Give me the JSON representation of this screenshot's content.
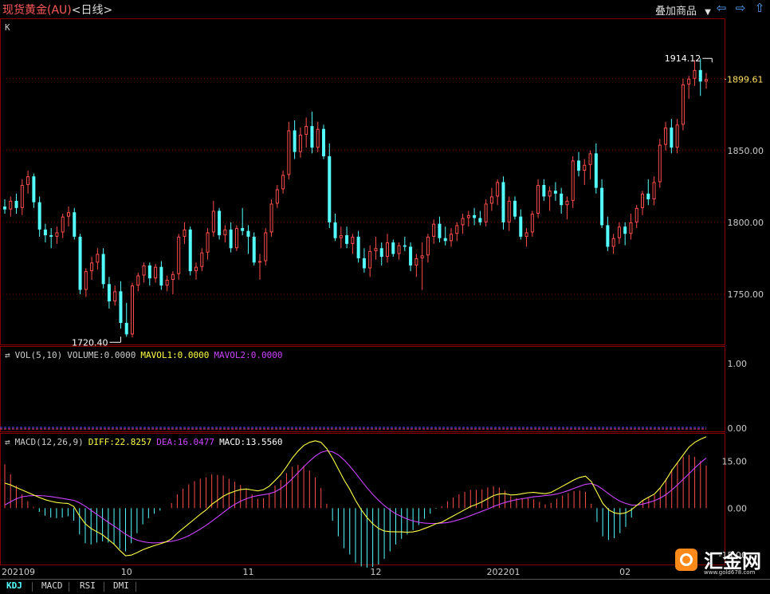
{
  "header": {
    "title": "现货黄金(AU)",
    "period": "<日线>",
    "overlay_label": "叠加商品",
    "overlay_arrow": "▼"
  },
  "colors": {
    "up": "#ff4d4d",
    "down": "#54ffff",
    "grid": "#8a0000",
    "diff": "#ffff44",
    "dea": "#cc44ff",
    "macd_up": "#ff4d4d",
    "macd_down": "#54ffff",
    "axis_text": "#cccccc",
    "vol_line": "#5050ff"
  },
  "main_panel": {
    "label": "K",
    "current_price": "1899.61",
    "high_label": "1914.12",
    "low_label": "1720.40"
  },
  "vol_panel": {
    "icon": "⇄",
    "name": "VOL(5,10)",
    "volume": "VOLUME:0.0000",
    "mavol1": "MAVOL1:0.0000",
    "mavol2": "MAVOL2:0.0000"
  },
  "macd_panel": {
    "icon": "⇄",
    "name": "MACD(12,26,9)",
    "diff": "DIFF:22.8257",
    "dea": "DEA:16.0477",
    "macd": "MACD:13.5560"
  },
  "tabs": [
    "KDJ",
    "MACD",
    "RSI",
    "DMI"
  ],
  "watermark": {
    "brand": "汇金网",
    "site": "www.gold678.com"
  },
  "chart_data": [
    {
      "type": "candlestick",
      "y_ticks": [
        1750,
        1800,
        1850
      ],
      "ylim": [
        1715,
        1942
      ],
      "x_tick_labels": [
        {
          "label": "202109",
          "index": 0
        },
        {
          "label": "10",
          "index": 21
        },
        {
          "label": "11",
          "index": 42
        },
        {
          "label": "12",
          "index": 64
        },
        {
          "label": "202201",
          "index": 86
        },
        {
          "label": "02",
          "index": 107
        }
      ],
      "annotations": [
        {
          "text": "1914.12",
          "value": 1914.12,
          "index": 122
        },
        {
          "text": "1720.40",
          "value": 1720.4,
          "index": 20
        },
        {
          "text": "1899.61",
          "value": 1899.61,
          "index": 124
        }
      ],
      "candles": [
        [
          1811,
          1816,
          1806,
          1809
        ],
        [
          1809,
          1818,
          1804,
          1815
        ],
        [
          1815,
          1820,
          1806,
          1810
        ],
        [
          1810,
          1830,
          1805,
          1826
        ],
        [
          1826,
          1836,
          1820,
          1832
        ],
        [
          1832,
          1834,
          1810,
          1814
        ],
        [
          1814,
          1818,
          1790,
          1795
        ],
        [
          1795,
          1799,
          1786,
          1791
        ],
        [
          1791,
          1796,
          1782,
          1790
        ],
        [
          1790,
          1797,
          1785,
          1793
        ],
        [
          1793,
          1806,
          1789,
          1804
        ],
        [
          1804,
          1811,
          1797,
          1807
        ],
        [
          1807,
          1810,
          1788,
          1790
        ],
        [
          1790,
          1792,
          1750,
          1753
        ],
        [
          1753,
          1768,
          1748,
          1766
        ],
        [
          1766,
          1776,
          1760,
          1772
        ],
        [
          1772,
          1782,
          1767,
          1778
        ],
        [
          1778,
          1782,
          1754,
          1757
        ],
        [
          1757,
          1762,
          1740,
          1745
        ],
        [
          1745,
          1756,
          1742,
          1752
        ],
        [
          1752,
          1759,
          1726,
          1730
        ],
        [
          1730,
          1744,
          1720.4,
          1722
        ],
        [
          1722,
          1758,
          1720,
          1756
        ],
        [
          1756,
          1765,
          1752,
          1763
        ],
        [
          1763,
          1772,
          1758,
          1770
        ],
        [
          1770,
          1772,
          1756,
          1761
        ],
        [
          1761,
          1771,
          1758,
          1769
        ],
        [
          1769,
          1773,
          1753,
          1756
        ],
        [
          1756,
          1763,
          1752,
          1760
        ],
        [
          1760,
          1766,
          1750,
          1764
        ],
        [
          1764,
          1792,
          1760,
          1790
        ],
        [
          1790,
          1800,
          1785,
          1795
        ],
        [
          1795,
          1797,
          1763,
          1766
        ],
        [
          1766,
          1772,
          1760,
          1769
        ],
        [
          1769,
          1782,
          1766,
          1779
        ],
        [
          1779,
          1796,
          1774,
          1793
        ],
        [
          1793,
          1815,
          1790,
          1808
        ],
        [
          1808,
          1810,
          1788,
          1791
        ],
        [
          1791,
          1798,
          1786,
          1795
        ],
        [
          1795,
          1800,
          1779,
          1782
        ],
        [
          1782,
          1798,
          1780,
          1796
        ],
        [
          1796,
          1810,
          1791,
          1794
        ],
        [
          1794,
          1798,
          1778,
          1790
        ],
        [
          1790,
          1793,
          1770,
          1772
        ],
        [
          1772,
          1778,
          1760,
          1773
        ],
        [
          1773,
          1796,
          1770,
          1793
        ],
        [
          1793,
          1816,
          1790,
          1813
        ],
        [
          1813,
          1826,
          1810,
          1823
        ],
        [
          1823,
          1836,
          1820,
          1833
        ],
        [
          1833,
          1870,
          1830,
          1864
        ],
        [
          1864,
          1871,
          1844,
          1849
        ],
        [
          1849,
          1866,
          1845,
          1861
        ],
        [
          1861,
          1873,
          1852,
          1867
        ],
        [
          1867,
          1877,
          1848,
          1852
        ],
        [
          1852,
          1870,
          1849,
          1865
        ],
        [
          1865,
          1868,
          1844,
          1846
        ],
        [
          1846,
          1855,
          1796,
          1800
        ],
        [
          1800,
          1806,
          1787,
          1789
        ],
        [
          1789,
          1797,
          1782,
          1791
        ],
        [
          1791,
          1797,
          1782,
          1785
        ],
        [
          1785,
          1792,
          1778,
          1790
        ],
        [
          1790,
          1794,
          1772,
          1775
        ],
        [
          1775,
          1782,
          1765,
          1768
        ],
        [
          1768,
          1784,
          1762,
          1780
        ],
        [
          1780,
          1790,
          1774,
          1782
        ],
        [
          1782,
          1786,
          1770,
          1776
        ],
        [
          1776,
          1792,
          1772,
          1786
        ],
        [
          1786,
          1788,
          1776,
          1778
        ],
        [
          1778,
          1786,
          1774,
          1784
        ],
        [
          1784,
          1790,
          1780,
          1783
        ],
        [
          1783,
          1786,
          1766,
          1770
        ],
        [
          1770,
          1778,
          1762,
          1775
        ],
        [
          1775,
          1786,
          1753,
          1777
        ],
        [
          1777,
          1792,
          1772,
          1790
        ],
        [
          1790,
          1802,
          1785,
          1799
        ],
        [
          1799,
          1804,
          1786,
          1789
        ],
        [
          1789,
          1797,
          1784,
          1787
        ],
        [
          1787,
          1796,
          1783,
          1792
        ],
        [
          1792,
          1800,
          1787,
          1798
        ],
        [
          1798,
          1806,
          1792,
          1803
        ],
        [
          1803,
          1808,
          1797,
          1805
        ],
        [
          1805,
          1810,
          1798,
          1803
        ],
        [
          1803,
          1808,
          1798,
          1800
        ],
        [
          1800,
          1816,
          1797,
          1813
        ],
        [
          1813,
          1824,
          1808,
          1818
        ],
        [
          1818,
          1830,
          1812,
          1828
        ],
        [
          1828,
          1832,
          1795,
          1800
        ],
        [
          1800,
          1818,
          1794,
          1815
        ],
        [
          1815,
          1818,
          1802,
          1804
        ],
        [
          1804,
          1809,
          1788,
          1790
        ],
        [
          1790,
          1796,
          1783,
          1793
        ],
        [
          1793,
          1808,
          1790,
          1806
        ],
        [
          1806,
          1830,
          1803,
          1826
        ],
        [
          1826,
          1830,
          1815,
          1818
        ],
        [
          1818,
          1825,
          1808,
          1822
        ],
        [
          1822,
          1828,
          1815,
          1820
        ],
        [
          1820,
          1824,
          1806,
          1812
        ],
        [
          1812,
          1818,
          1802,
          1815
        ],
        [
          1815,
          1846,
          1810,
          1843
        ],
        [
          1843,
          1849,
          1832,
          1836
        ],
        [
          1836,
          1844,
          1826,
          1840
        ],
        [
          1840,
          1850,
          1830,
          1848
        ],
        [
          1848,
          1855,
          1820,
          1824
        ],
        [
          1824,
          1830,
          1796,
          1798
        ],
        [
          1798,
          1804,
          1780,
          1783
        ],
        [
          1783,
          1792,
          1778,
          1789
        ],
        [
          1789,
          1800,
          1785,
          1797
        ],
        [
          1797,
          1800,
          1784,
          1792
        ],
        [
          1792,
          1806,
          1788,
          1800
        ],
        [
          1800,
          1812,
          1796,
          1810
        ],
        [
          1810,
          1822,
          1805,
          1820
        ],
        [
          1820,
          1830,
          1812,
          1816
        ],
        [
          1816,
          1832,
          1812,
          1828
        ],
        [
          1828,
          1858,
          1824,
          1854
        ],
        [
          1854,
          1870,
          1850,
          1866
        ],
        [
          1866,
          1872,
          1848,
          1852
        ],
        [
          1852,
          1872,
          1848,
          1868
        ],
        [
          1868,
          1900,
          1864,
          1896
        ],
        [
          1896,
          1902,
          1886,
          1900
        ],
        [
          1900,
          1913,
          1895,
          1906
        ],
        [
          1906,
          1914.12,
          1888,
          1898
        ],
        [
          1898,
          1904,
          1893,
          1899.61
        ]
      ]
    },
    {
      "type": "line",
      "title": "VOL(5,10)",
      "y_ticks": [
        0.0,
        1.0
      ],
      "ylim": [
        0,
        1.2
      ],
      "series": [
        {
          "name": "VOLUME",
          "value": 0.0
        },
        {
          "name": "MAVOL1",
          "value": 0.0
        },
        {
          "name": "MAVOL2",
          "value": 0.0
        }
      ]
    },
    {
      "type": "line",
      "title": "MACD(12,26,9)",
      "y_ticks": [
        -15.0,
        0.0,
        15.0
      ],
      "ylim": [
        -18,
        24
      ],
      "series": [
        {
          "name": "DIFF",
          "values": [
            8,
            7.4,
            6.6,
            5.8,
            5,
            4.2,
            3.4,
            2.7,
            2.2,
            1.8,
            1.6,
            1.5,
            0.5,
            -2.5,
            -5,
            -6.5,
            -7.5,
            -8.5,
            -10,
            -11.5,
            -13.5,
            -15.2,
            -15,
            -14.2,
            -13.3,
            -12.6,
            -12,
            -11.4,
            -10.8,
            -9.8,
            -8,
            -6.5,
            -5,
            -3.5,
            -2,
            -0.6,
            1.2,
            2.5,
            3.8,
            4.7,
            5.4,
            5.9,
            6.1,
            5.8,
            5.5,
            5.9,
            7,
            8.8,
            10.7,
            13.2,
            16,
            18.2,
            20,
            21,
            21.5,
            21,
            19,
            16,
            12.5,
            9,
            6,
            2.5,
            -0.5,
            -3,
            -5,
            -6.5,
            -7.3,
            -7.5,
            -7.6,
            -7.6,
            -7.7,
            -7.6,
            -7.2,
            -6.5,
            -5.8,
            -5,
            -4.5,
            -3.5,
            -2.5,
            -1.5,
            -0.5,
            0.5,
            1.2,
            2,
            3,
            4,
            4.5,
            4.6,
            4.2,
            4.3,
            4.6,
            4.9,
            5,
            4.8,
            4.6,
            5,
            6,
            7,
            8,
            9,
            9.8,
            10.2,
            8.5,
            5,
            1.5,
            -0.5,
            -1.5,
            -1.8,
            -1.5,
            -0.5,
            1,
            2.5,
            3.5,
            4.5,
            6.5,
            9,
            12,
            14.5,
            17,
            19.5,
            21,
            22,
            22.8
          ]
        },
        {
          "name": "DEA",
          "values": [
            1,
            2,
            3,
            3.6,
            3.9,
            4,
            4,
            3.9,
            3.7,
            3.4,
            3.1,
            2.8,
            2.5,
            1.7,
            0.6,
            -0.7,
            -2,
            -3.2,
            -4.5,
            -5.7,
            -7,
            -8.3,
            -9.4,
            -10.2,
            -10.7,
            -11,
            -11.1,
            -11,
            -10.8,
            -10.6,
            -10.2,
            -9.6,
            -8.8,
            -7.8,
            -6.7,
            -5.5,
            -4.2,
            -2.8,
            -1.4,
            0,
            1.2,
            2.2,
            3,
            3.6,
            4,
            4.3,
            4.6,
            5.2,
            6.2,
            7.6,
            9.4,
            11.3,
            13.2,
            15,
            16.6,
            17.8,
            18.3,
            18,
            17,
            15.4,
            13.4,
            11.2,
            8.8,
            6.5,
            4.4,
            2.5,
            0.8,
            -0.6,
            -1.8,
            -2.7,
            -3.5,
            -4.1,
            -4.5,
            -4.8,
            -4.9,
            -4.9,
            -4.8,
            -4.6,
            -4.2,
            -3.7,
            -3.1,
            -2.4,
            -1.7,
            -1,
            -0.3,
            0.5,
            1.2,
            1.8,
            2.3,
            2.7,
            3,
            3.3,
            3.6,
            3.8,
            4,
            4.2,
            4.5,
            5,
            5.6,
            6.3,
            7,
            7.6,
            7.8,
            7.2,
            6,
            4.6,
            3.3,
            2.2,
            1.5,
            1,
            1,
            1.3,
            1.8,
            2.4,
            3.2,
            4.3,
            5.8,
            7.4,
            9.2,
            11,
            12.8,
            14.5,
            16
          ]
        },
        {
          "name": "MACD",
          "values": [
            14,
            10.8,
            7.2,
            4.4,
            2.2,
            0.4,
            -1.2,
            -2.4,
            -3,
            -3.2,
            -3,
            -2.6,
            -4,
            -8.4,
            -11.2,
            -11.6,
            -11,
            -10.6,
            -11,
            -11.6,
            -13,
            -13.8,
            -11.2,
            -8,
            -5.2,
            -3.2,
            -1.8,
            -0.8,
            0,
            1.6,
            4.4,
            6.2,
            7.6,
            8.6,
            9.4,
            9.8,
            10.8,
            10.6,
            10.4,
            9.4,
            8.4,
            7.4,
            6.2,
            4.4,
            3,
            3.2,
            4.8,
            7.2,
            9,
            11.2,
            13.2,
            13.8,
            13.6,
            12,
            9.8,
            6.4,
            1.4,
            -4,
            -9,
            -12.8,
            -14.8,
            -17.4,
            -18.6,
            -19,
            -18.8,
            -18,
            -16.2,
            -13.8,
            -11.6,
            -9.8,
            -8.4,
            -7,
            -5.4,
            -3.4,
            -1.8,
            -0.2,
            0.6,
            2.2,
            3.4,
            4.4,
            5.2,
            5.8,
            5.8,
            6,
            6.6,
            7,
            6.6,
            5.6,
            3.8,
            3.2,
            3.2,
            3.2,
            2.8,
            2,
            1.2,
            1.6,
            3,
            4,
            4.8,
            5.4,
            5.6,
            5.2,
            1.4,
            -4.4,
            -9,
            -10.2,
            -9.6,
            -8,
            -6,
            -3,
            0,
            2.4,
            3.4,
            4.2,
            6.6,
            9.4,
            12.4,
            14.4,
            16.4,
            17,
            16.4,
            15,
            13.6
          ]
        }
      ]
    }
  ]
}
